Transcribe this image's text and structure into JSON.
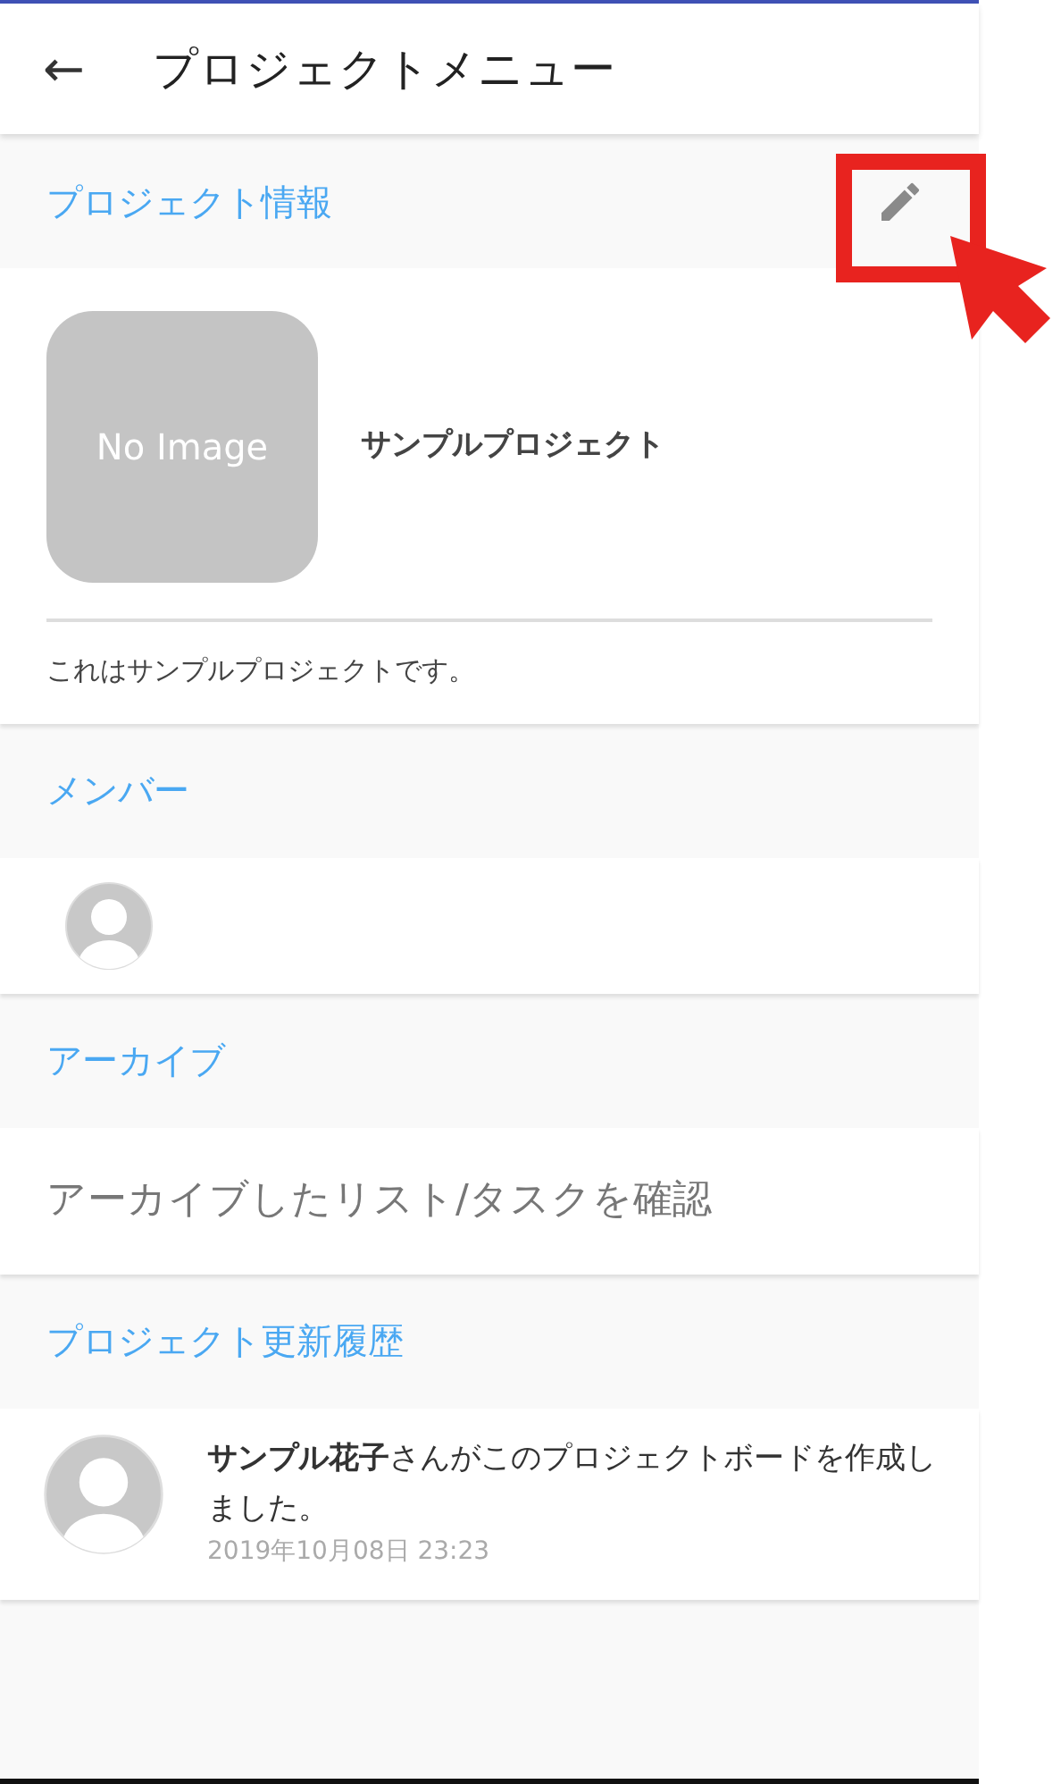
{
  "app_bar": {
    "back": "←",
    "title": "プロジェクトメニュー"
  },
  "project_info": {
    "heading": "プロジェクト情報",
    "image_placeholder": "No Image",
    "name": "サンプルプロジェクト",
    "description": "これはサンプルプロジェクトです。",
    "edit_highlighted": true
  },
  "members": {
    "heading": "メンバー",
    "avatars": [
      {
        "kind": "person"
      }
    ]
  },
  "archive": {
    "heading": "アーカイブ",
    "link": "アーカイブしたリスト/タスクを確認"
  },
  "history": {
    "heading": "プロジェクト更新履歴",
    "entries": [
      {
        "text": "**サンプル花子**さんがこのプロジェクトボードを作成しました。",
        "time": "2019年10月08日 23:23"
      }
    ]
  }
}
